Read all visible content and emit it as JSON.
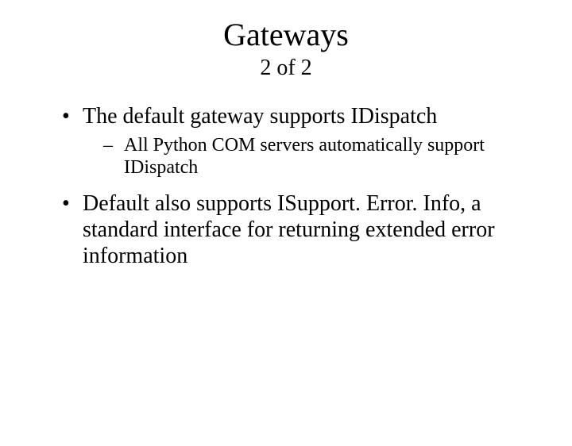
{
  "title": "Gateways",
  "subtitle": "2 of 2",
  "bullets": [
    {
      "text": "The default gateway supports IDispatch",
      "sub": [
        "All Python COM servers automatically support IDispatch"
      ]
    },
    {
      "text": "Default also supports ISupport. Error. Info, a standard interface for returning extended error information",
      "sub": []
    }
  ]
}
